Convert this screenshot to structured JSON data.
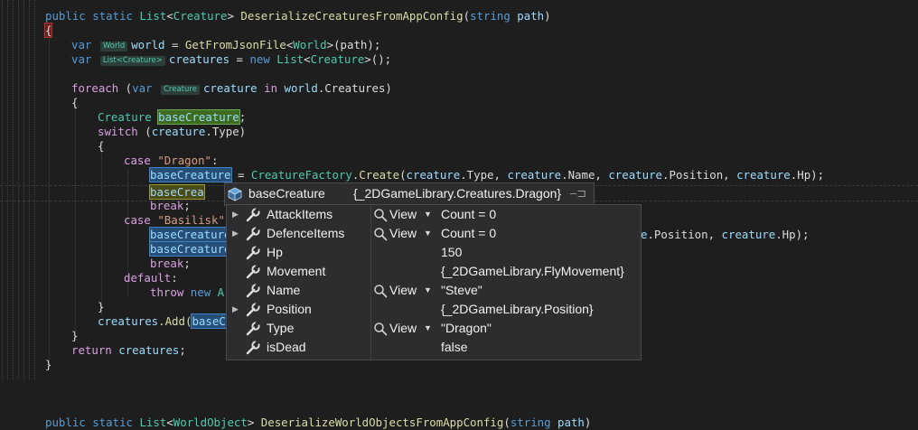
{
  "editor": {
    "lines": {
      "l1": {
        "kw1": "public",
        "kw2": "static",
        "type_list": "List",
        "lt": "<",
        "type_creature": "Creature",
        "gt": ">",
        "method": "DeserializeCreaturesFromAppConfig",
        "open": "(",
        "kw_string": "string",
        "param": "path",
        "close": ")"
      },
      "l2": {
        "brace": "{"
      },
      "l3": {
        "kw": "var",
        "hint": "World",
        "var": "world",
        "eq": " = ",
        "fn": "GetFromJsonFile",
        "lt": "<",
        "type": "World",
        "gt": ">",
        "args": "(path);"
      },
      "l4": {
        "kw": "var",
        "hint": "List<Creature>",
        "var": "creatures",
        "eq": " = ",
        "kw_new": "new",
        "type_list": "List",
        "lt": "<",
        "type": "Creature",
        "gt": ">",
        "end": "();"
      },
      "l6": {
        "kw": "foreach",
        "open": " (",
        "kw_var": "var",
        "hint": "Creature",
        "var": "creature",
        "kw_in": "in",
        "obj": "world",
        "member": ".Creatures)"
      },
      "l7": {
        "brace": "{"
      },
      "l8": {
        "type": "Creature",
        "var": "baseCreature",
        "end": ";"
      },
      "l9": {
        "kw": "switch",
        "open": " (",
        "var": "creature",
        "member": ".Type)"
      },
      "l10": {
        "brace": "{"
      },
      "l11": {
        "kw": "case",
        "str": "\"Dragon\"",
        "colon": ":"
      },
      "l12": {
        "var": "baseCreature",
        "eq": " = ",
        "type": "CreatureFactory",
        "dot": ".",
        "fn": "Create",
        "args_a": "(",
        "a1": "creature",
        "a1m": ".Type, ",
        "a2": "creature",
        "a2m": ".Name, ",
        "a3": "creature",
        "a3m": ".Position, ",
        "a4": "creature",
        "a4m": ".Hp);"
      },
      "l13": {
        "var": "baseCrea"
      },
      "l14": {
        "kw": "break",
        "end": ";"
      },
      "l15": {
        "kw": "case",
        "str": "\"Basilisk\""
      },
      "l16": {
        "var": "baseCreature",
        "tail_a": "e",
        "tail_pos": ".Position, ",
        "tail_obj": "creature",
        "tail_hp": ".Hp);"
      },
      "l17": {
        "var": "baseCreature"
      },
      "l18": {
        "kw": "break",
        "end": ";"
      },
      "l19": {
        "kw": "default",
        "colon": ":"
      },
      "l20": {
        "kw": "throw",
        "kw2": "new",
        "type": "Ar"
      },
      "l21": {
        "brace": "}"
      },
      "l22": {
        "obj": "creatures",
        "fn": ".Add(",
        "var": "baseCr"
      },
      "l23": {
        "brace": "}"
      },
      "l24": {
        "kw": "return",
        "var": "creatures",
        "end": ";"
      },
      "l25": {
        "brace": "}"
      },
      "l28": {
        "kw1": "public",
        "kw2": "static",
        "type_list": "List",
        "lt": "<",
        "type": "WorldObject",
        "gt": ">",
        "method": "DeserializeWorldObjectsFromAppConfig",
        "open": "(",
        "kw_string": "string",
        "param": "path",
        "close": ")"
      }
    }
  },
  "datatip": {
    "header": {
      "name": "baseCreature",
      "value": "{_2DGameLibrary.Creatures.Dragon}",
      "expander_icon": "triangle-down-icon",
      "type_icon": "object-cube-icon",
      "pin_icon": "pin-icon",
      "pin_glyph": "–⊐"
    },
    "view_label": "View",
    "rows": [
      {
        "name": "AttackItems",
        "has_expander": true,
        "has_view": true,
        "value": "Count = 0"
      },
      {
        "name": "DefenceItems",
        "has_expander": true,
        "has_view": true,
        "value": "Count = 0"
      },
      {
        "name": "Hp",
        "has_expander": false,
        "has_view": false,
        "value": "150"
      },
      {
        "name": "Movement",
        "has_expander": false,
        "has_view": false,
        "value": "{_2DGameLibrary.FlyMovement}"
      },
      {
        "name": "Name",
        "has_expander": false,
        "has_view": true,
        "value": "\"Steve\""
      },
      {
        "name": "Position",
        "has_expander": true,
        "has_view": false,
        "value": "{_2DGameLibrary.Position}"
      },
      {
        "name": "Type",
        "has_expander": false,
        "has_view": true,
        "value": "\"Dragon\""
      },
      {
        "name": "isDead",
        "has_expander": false,
        "has_view": false,
        "value": "false"
      }
    ]
  },
  "colors": {
    "background": "#1e1e1e",
    "keyword": "#569cd6",
    "control": "#d8a0df",
    "type": "#4ec9b0",
    "method": "#dcdcaa",
    "variable": "#9cdcfe",
    "string": "#d69d85",
    "tooltip_bg": "#2d2d30"
  }
}
